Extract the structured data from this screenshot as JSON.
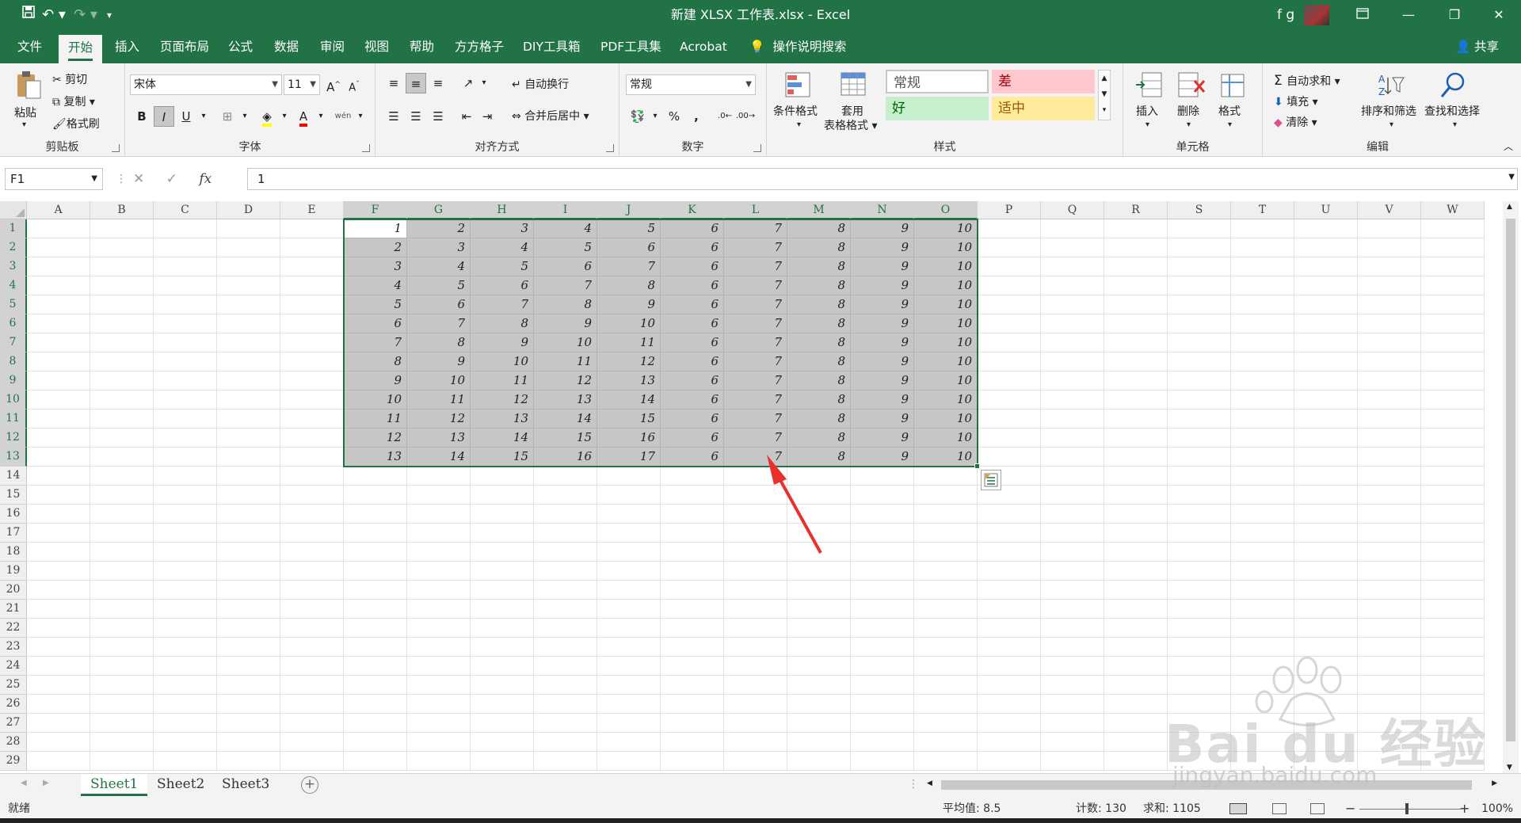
{
  "window": {
    "title": "新建 XLSX 工作表.xlsx  -  Excel",
    "user": "f g",
    "share": "共享"
  },
  "quick_access": [
    "save-icon",
    "undo-icon",
    "redo-icon",
    "customize-icon"
  ],
  "menu_tabs": [
    "文件",
    "开始",
    "插入",
    "页面布局",
    "公式",
    "数据",
    "审阅",
    "视图",
    "帮助",
    "方方格子",
    "DIY工具箱",
    "PDF工具集",
    "Acrobat"
  ],
  "active_tab": "开始",
  "tell_me": "操作说明搜索",
  "ribbon": {
    "clipboard": {
      "label": "剪贴板",
      "paste": "粘贴",
      "cut": "剪切",
      "copy": "复制",
      "format_painter": "格式刷"
    },
    "font": {
      "label": "字体",
      "font_name": "宋体",
      "font_size": "11",
      "bold": "B",
      "italic": "I",
      "underline": "U",
      "phonetic": "wén"
    },
    "alignment": {
      "label": "对齐方式",
      "wrap_text": "自动换行",
      "merge_center": "合并后居中"
    },
    "number": {
      "label": "数字",
      "format": "常规",
      "percent": "%",
      "comma": ","
    },
    "styles": {
      "label": "样式",
      "conditional": "条件格式",
      "table_line1": "套用",
      "table_line2": "表格格式",
      "normal": "常规",
      "bad": "差",
      "good": "好",
      "neutral": "适中"
    },
    "cells": {
      "label": "单元格",
      "insert": "插入",
      "delete": "删除",
      "format": "格式"
    },
    "editing": {
      "label": "编辑",
      "autosum": "自动求和",
      "fill": "填充",
      "clear": "清除",
      "sort_filter": "排序和筛选",
      "find_select": "查找和选择"
    }
  },
  "formula_bar": {
    "name_box": "F1",
    "fx": "fx",
    "value": "1"
  },
  "columns": [
    "A",
    "B",
    "C",
    "D",
    "E",
    "F",
    "G",
    "H",
    "I",
    "J",
    "K",
    "L",
    "M",
    "N",
    "O",
    "P",
    "Q",
    "R",
    "S",
    "T",
    "U",
    "V",
    "W"
  ],
  "rows": [
    "1",
    "2",
    "3",
    "4",
    "5",
    "6",
    "7",
    "8",
    "9",
    "10",
    "11",
    "12",
    "13",
    "14",
    "15",
    "16",
    "17",
    "18",
    "19",
    "20",
    "21",
    "22",
    "23",
    "24",
    "25",
    "26",
    "27",
    "28",
    "29"
  ],
  "selection": {
    "range": "F1:O13",
    "active_cell": "F1"
  },
  "cell_values": [
    [
      "1",
      "2",
      "3",
      "4",
      "5",
      "6",
      "7",
      "8",
      "9",
      "10"
    ],
    [
      "2",
      "3",
      "4",
      "5",
      "6",
      "6",
      "7",
      "8",
      "9",
      "10"
    ],
    [
      "3",
      "4",
      "5",
      "6",
      "7",
      "6",
      "7",
      "8",
      "9",
      "10"
    ],
    [
      "4",
      "5",
      "6",
      "7",
      "8",
      "6",
      "7",
      "8",
      "9",
      "10"
    ],
    [
      "5",
      "6",
      "7",
      "8",
      "9",
      "6",
      "7",
      "8",
      "9",
      "10"
    ],
    [
      "6",
      "7",
      "8",
      "9",
      "10",
      "6",
      "7",
      "8",
      "9",
      "10"
    ],
    [
      "7",
      "8",
      "9",
      "10",
      "11",
      "6",
      "7",
      "8",
      "9",
      "10"
    ],
    [
      "8",
      "9",
      "10",
      "11",
      "12",
      "6",
      "7",
      "8",
      "9",
      "10"
    ],
    [
      "9",
      "10",
      "11",
      "12",
      "13",
      "6",
      "7",
      "8",
      "9",
      "10"
    ],
    [
      "10",
      "11",
      "12",
      "13",
      "14",
      "6",
      "7",
      "8",
      "9",
      "10"
    ],
    [
      "11",
      "12",
      "13",
      "14",
      "15",
      "6",
      "7",
      "8",
      "9",
      "10"
    ],
    [
      "12",
      "13",
      "14",
      "15",
      "16",
      "6",
      "7",
      "8",
      "9",
      "10"
    ],
    [
      "13",
      "14",
      "15",
      "16",
      "17",
      "6",
      "7",
      "8",
      "9",
      "10"
    ]
  ],
  "sheets": [
    "Sheet1",
    "Sheet2",
    "Sheet3"
  ],
  "active_sheet": "Sheet1",
  "status": {
    "ready": "就绪",
    "average": "平均值: 8.5",
    "count": "计数: 130",
    "sum": "求和: 1105",
    "zoom": "100%"
  },
  "watermark": {
    "text": "Bai du 经验",
    "url": "jingyan.baidu.com"
  },
  "colors": {
    "accent": "#217346",
    "selection_fill": "#c6c6c6",
    "annotation_arrow": "#e8312c"
  }
}
